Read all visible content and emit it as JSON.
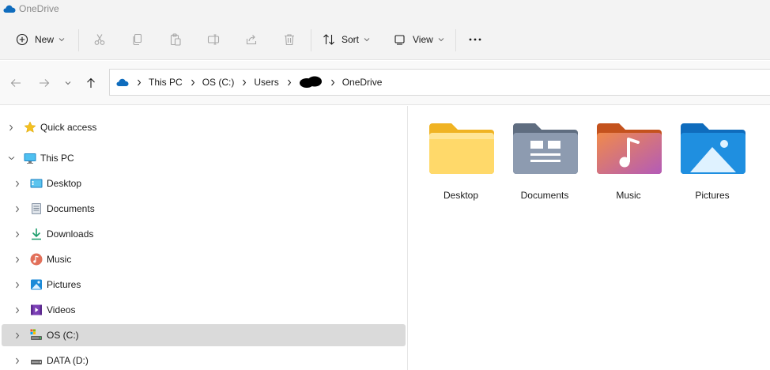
{
  "window": {
    "title": "OneDrive",
    "app_icon": "onedrive-cloud-icon"
  },
  "toolbar": {
    "new_label": "New",
    "sort_label": "Sort",
    "view_label": "View",
    "icons": [
      "plus-circle-icon",
      "cut-icon",
      "copy-icon",
      "paste-icon",
      "rename-icon",
      "share-icon",
      "delete-icon",
      "sort-icon",
      "view-icon",
      "more-icon"
    ]
  },
  "address": {
    "breadcrumbs": [
      "This PC",
      "OS (C:)",
      "Users",
      "",
      "OneDrive"
    ],
    "redacted_index": 3
  },
  "nav": {
    "items": [
      {
        "label": "Quick access",
        "icon": "star-icon"
      },
      {
        "label": "This PC",
        "icon": "monitor-icon",
        "expanded": true
      },
      {
        "label": "Desktop",
        "icon": "desktop-icon"
      },
      {
        "label": "Documents",
        "icon": "document-icon"
      },
      {
        "label": "Downloads",
        "icon": "download-icon"
      },
      {
        "label": "Music",
        "icon": "music-icon"
      },
      {
        "label": "Pictures",
        "icon": "pictures-icon"
      },
      {
        "label": "Videos",
        "icon": "video-icon"
      },
      {
        "label": "OS (C:)",
        "icon": "drive-c-icon",
        "selected": true
      },
      {
        "label": "DATA (D:)",
        "icon": "drive-d-icon"
      }
    ]
  },
  "content": {
    "folders": [
      {
        "label": "Desktop",
        "icon": "desktop-folder-icon"
      },
      {
        "label": "Documents",
        "icon": "documents-folder-icon"
      },
      {
        "label": "Music",
        "icon": "music-folder-icon"
      },
      {
        "label": "Pictures",
        "icon": "pictures-folder-icon"
      }
    ]
  },
  "colors": {
    "accent": "#0067c0",
    "folder_yellow": "#ffd35a",
    "selected_bg": "#dadada",
    "toolbar_bg": "#f3f3f3"
  }
}
